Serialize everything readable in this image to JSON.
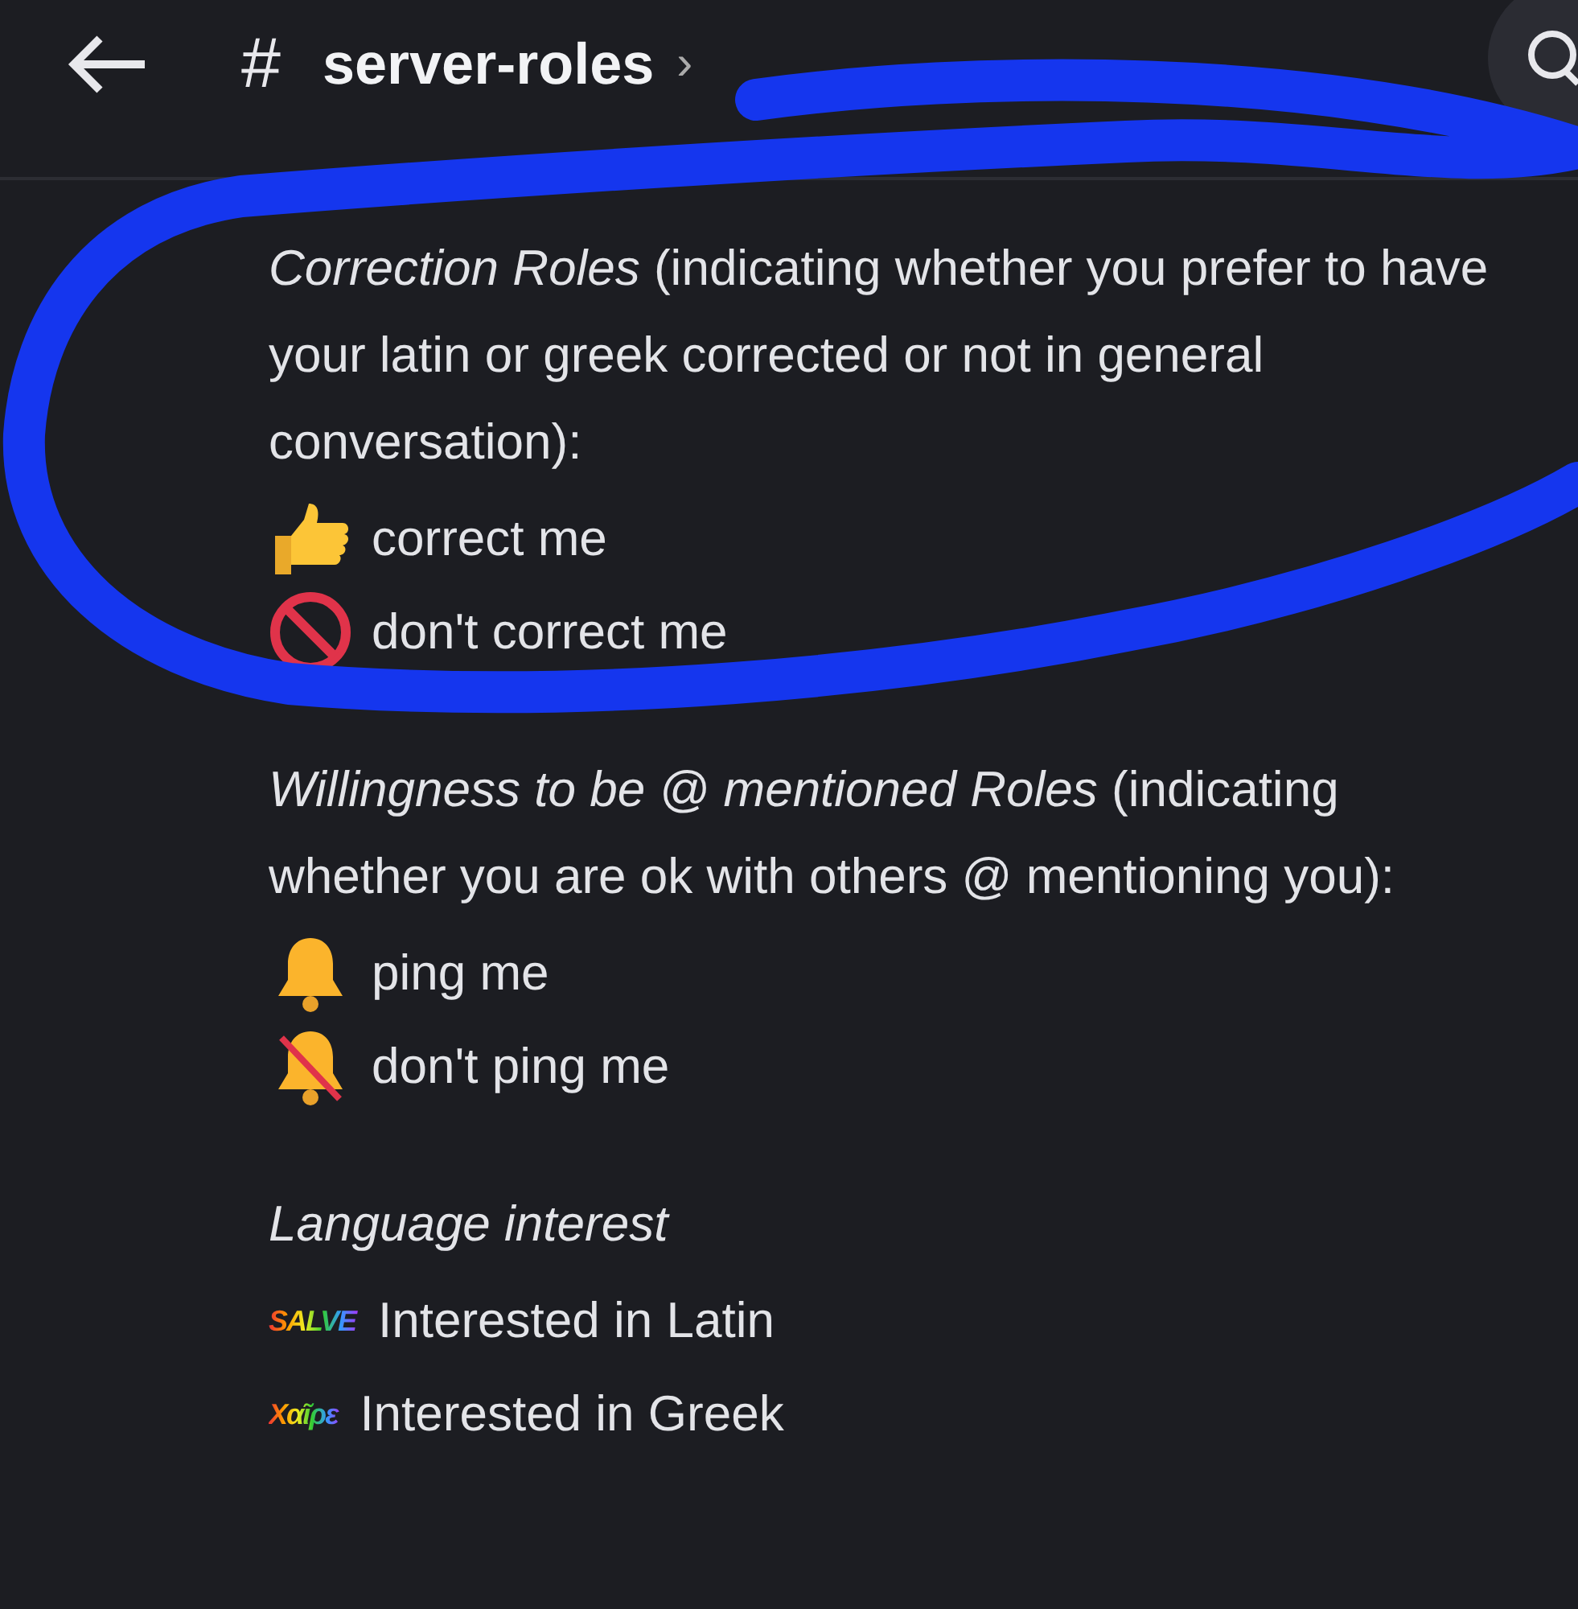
{
  "header": {
    "channel": "server-roles",
    "hash": "#",
    "chevron": "›"
  },
  "sections": [
    {
      "heading": "*Correction Roles* (indicating whether you prefer to have your latin or greek corrected or not in general conversation):",
      "items": [
        {
          "kind": "thumbs-up",
          "label": "correct me"
        },
        {
          "kind": "prohibited",
          "label": "don't correct me"
        }
      ]
    },
    {
      "heading": "*Willingness to be @ mentioned Roles* (indicating whether you are ok with others @ mentioning you):",
      "items": [
        {
          "kind": "bell",
          "label": "ping me"
        },
        {
          "kind": "bell-off",
          "label": "don't ping me"
        }
      ]
    },
    {
      "heading": "*Language interest*",
      "items": [
        {
          "kind": "word",
          "emoji": "SALVE",
          "label": "Interested in Latin"
        },
        {
          "kind": "word",
          "emoji": "Χαῖρε",
          "label": "Interested in Greek"
        }
      ]
    }
  ],
  "annotation": {
    "kind": "scribble"
  }
}
